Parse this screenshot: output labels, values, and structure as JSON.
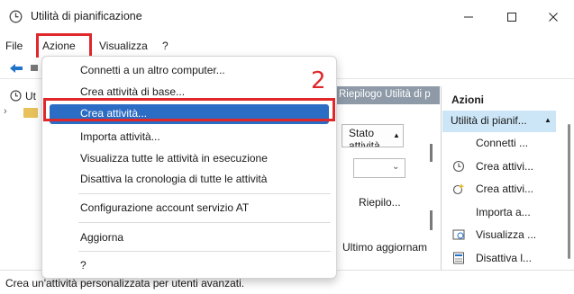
{
  "window": {
    "title": "Utilità di pianificazione",
    "icon": "clock-icon",
    "controls": [
      "minimize-icon",
      "maximize-icon",
      "close-icon"
    ]
  },
  "menubar": {
    "items": [
      "File",
      "Azione",
      "Visualizza",
      "?"
    ],
    "highlighted": "Azione"
  },
  "tree": {
    "label": "Ut"
  },
  "dropdown": {
    "items": [
      "Connetti a un altro computer...",
      "Crea attività di base...",
      "Crea attività...",
      "Importa attività...",
      "Visualizza tutte le attività in esecuzione",
      "Disattiva la cronologia di tutte le attività",
      "Configurazione account servizio AT",
      "Aggiorna",
      "?"
    ],
    "selected": "Crea attività...",
    "step_number": "2"
  },
  "center": {
    "header": "Riepilogo Utilità di p",
    "stato_button": "Stato attività",
    "riepilogo": "Riepilo...",
    "ultimo": "Ultimo aggiornam"
  },
  "actions": {
    "title": "Azioni",
    "group": "Utilità di pianif...",
    "items": [
      {
        "label": "Connetti ...",
        "icon": ""
      },
      {
        "label": "Crea attivi...",
        "icon": "create-basic-task-icon"
      },
      {
        "label": "Crea attivi...",
        "icon": "create-task-icon"
      },
      {
        "label": "Importa a...",
        "icon": ""
      },
      {
        "label": "Visualizza ...",
        "icon": "running-tasks-icon"
      },
      {
        "label": "Disattiva l...",
        "icon": "disable-history-icon"
      }
    ]
  },
  "statusbar": {
    "text": "Crea un'attività personalizzata per utenti avanzati."
  },
  "colors": {
    "highlight_red": "#e0282b",
    "selection_blue": "#2b6cc4",
    "action_group_bg": "#cde6f7",
    "center_header_bg": "#8e9aa8"
  }
}
